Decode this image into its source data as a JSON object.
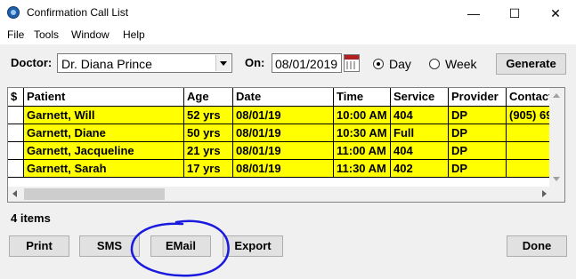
{
  "window": {
    "title": "Confirmation Call List",
    "minimize_glyph": "—",
    "maximize_glyph": "☐",
    "close_glyph": "✕"
  },
  "menu": [
    "File",
    "Tools",
    "Window",
    "Help"
  ],
  "filters": {
    "doctor_label": "Doctor:",
    "doctor_value": "Dr. Diana Prince",
    "on_label": "On:",
    "date_value": "08/01/2019",
    "day_label": "Day",
    "week_label": "Week",
    "selected_period": "Day",
    "generate_label": "Generate"
  },
  "table": {
    "columns": [
      "$",
      "Patient",
      "Age",
      "Date",
      "Time",
      "Service",
      "Provider",
      "Contact"
    ],
    "rows": [
      [
        "",
        "Garnett, Will",
        "52 yrs",
        "08/01/19",
        "10:00 AM",
        "404",
        "DP",
        "(905) 69"
      ],
      [
        "",
        "Garnett, Diane",
        "50 yrs",
        "08/01/19",
        "10:30 AM",
        "Full",
        "DP",
        ""
      ],
      [
        "",
        "Garnett, Jacqueline",
        "21 yrs",
        "08/01/19",
        "11:00 AM",
        "404",
        "DP",
        ""
      ],
      [
        "",
        "Garnett, Sarah",
        "17 yrs",
        "08/01/19",
        "11:30 AM",
        "402",
        "DP",
        ""
      ]
    ],
    "row_color": "#ffff00"
  },
  "status": {
    "items_count": "4 items"
  },
  "buttons": {
    "print": "Print",
    "sms": "SMS",
    "email": "EMail",
    "export": "Export",
    "done": "Done"
  },
  "annotation": {
    "color": "#1a1adf"
  }
}
